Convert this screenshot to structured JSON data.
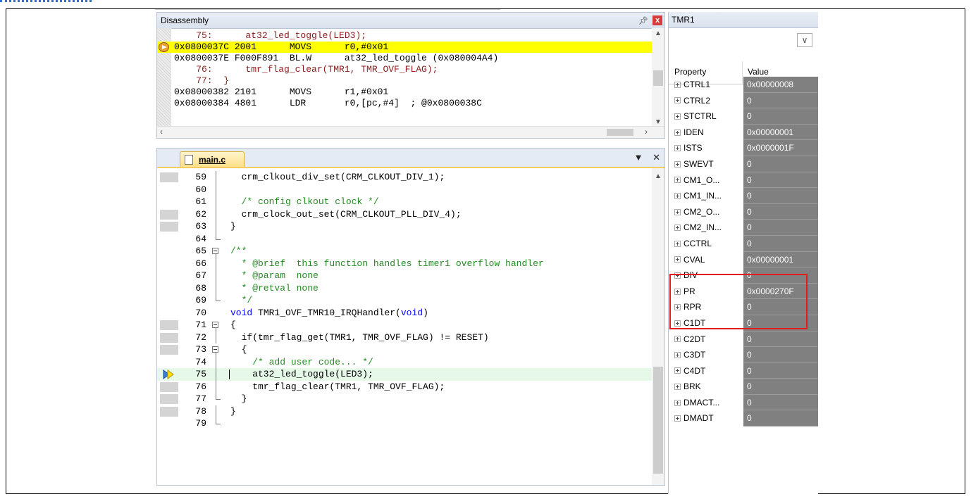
{
  "disassembly": {
    "title": "Disassembly",
    "lines": [
      {
        "text": "    75:      at32_led_toggle(LED3);",
        "kind": "src"
      },
      {
        "text": "0x0800037C 2001      MOVS      r0,#0x01",
        "kind": "hl"
      },
      {
        "text": "0x0800037E F000F891  BL.W      at32_led_toggle (0x080004A4)",
        "kind": "asm"
      },
      {
        "text": "    76:      tmr_flag_clear(TMR1, TMR_OVF_FLAG);",
        "kind": "src"
      },
      {
        "text": "    77:  }",
        "kind": "src"
      },
      {
        "text": "0x08000382 2101      MOVS      r1,#0x01",
        "kind": "asm"
      },
      {
        "text": "0x08000384 4801      LDR       r0,[pc,#4]  ; @0x0800038C",
        "kind": "asm"
      }
    ]
  },
  "editor": {
    "tab_label": "main.c",
    "lines": [
      {
        "num": "59",
        "text": "  crm_clkout_div_set(CRM_CLKOUT_DIV_1);",
        "mark": true,
        "fold": "v"
      },
      {
        "num": "60",
        "text": "",
        "mark": false,
        "fold": "v"
      },
      {
        "num": "61",
        "text": "  /* config clkout clock */",
        "mark": false,
        "fold": "v",
        "color": "green"
      },
      {
        "num": "62",
        "text": "  crm_clock_out_set(CRM_CLKOUT_PLL_DIV_4);",
        "mark": true,
        "fold": "v"
      },
      {
        "num": "63",
        "text": "}",
        "mark": true,
        "fold": "v"
      },
      {
        "num": "64",
        "text": "",
        "mark": false,
        "fold": "end"
      },
      {
        "num": "65",
        "text": "/**",
        "mark": false,
        "fold": "box",
        "color": "green"
      },
      {
        "num": "66",
        "text": "  * @brief  this function handles timer1 overflow handler",
        "mark": false,
        "fold": "v",
        "color": "green"
      },
      {
        "num": "67",
        "text": "  * @param  none",
        "mark": false,
        "fold": "v",
        "color": "green"
      },
      {
        "num": "68",
        "text": "  * @retval none",
        "mark": false,
        "fold": "v",
        "color": "green"
      },
      {
        "num": "69",
        "text": "  */",
        "mark": false,
        "fold": "end",
        "color": "green"
      },
      {
        "num": "70",
        "text": "void TMR1_OVF_TMR10_IRQHandler(void)",
        "mark": false,
        "fold": "",
        "kw": true
      },
      {
        "num": "71",
        "text": "{",
        "mark": true,
        "fold": "box"
      },
      {
        "num": "72",
        "text": "  if(tmr_flag_get(TMR1, TMR_OVF_FLAG) != RESET)",
        "mark": true,
        "fold": "v"
      },
      {
        "num": "73",
        "text": "  {",
        "mark": true,
        "fold": "box"
      },
      {
        "num": "74",
        "text": "    /* add user code... */",
        "mark": false,
        "fold": "v",
        "color": "green"
      },
      {
        "num": "75",
        "text": "    at32_led_toggle(LED3);",
        "mark": false,
        "fold": "v",
        "current": true
      },
      {
        "num": "76",
        "text": "    tmr_flag_clear(TMR1, TMR_OVF_FLAG);",
        "mark": true,
        "fold": "v"
      },
      {
        "num": "77",
        "text": "  }",
        "mark": true,
        "fold": "end"
      },
      {
        "num": "78",
        "text": "}",
        "mark": true,
        "fold": "v"
      },
      {
        "num": "79",
        "text": "",
        "mark": false,
        "fold": "end"
      }
    ]
  },
  "tmr1": {
    "title": "TMR1",
    "col_property": "Property",
    "col_value": "Value",
    "rows": [
      {
        "name": "CTRL1",
        "value": "0x00000008"
      },
      {
        "name": "CTRL2",
        "value": "0"
      },
      {
        "name": "STCTRL",
        "value": "0"
      },
      {
        "name": "IDEN",
        "value": "0x00000001"
      },
      {
        "name": "ISTS",
        "value": "0x0000001F"
      },
      {
        "name": "SWEVT",
        "value": "0"
      },
      {
        "name": "CM1_O...",
        "value": "0"
      },
      {
        "name": "CM1_IN...",
        "value": "0"
      },
      {
        "name": "CM2_O...",
        "value": "0"
      },
      {
        "name": "CM2_IN...",
        "value": "0"
      },
      {
        "name": "CCTRL",
        "value": "0"
      },
      {
        "name": "CVAL",
        "value": "0x00000001"
      },
      {
        "name": "DIV",
        "value": "0"
      },
      {
        "name": "PR",
        "value": "0x0000270F"
      },
      {
        "name": "RPR",
        "value": "0"
      },
      {
        "name": "C1DT",
        "value": "0"
      },
      {
        "name": "C2DT",
        "value": "0"
      },
      {
        "name": "C3DT",
        "value": "0"
      },
      {
        "name": "C4DT",
        "value": "0"
      },
      {
        "name": "BRK",
        "value": "0"
      },
      {
        "name": "DMACT...",
        "value": "0"
      },
      {
        "name": "DMADT",
        "value": "0"
      }
    ]
  }
}
